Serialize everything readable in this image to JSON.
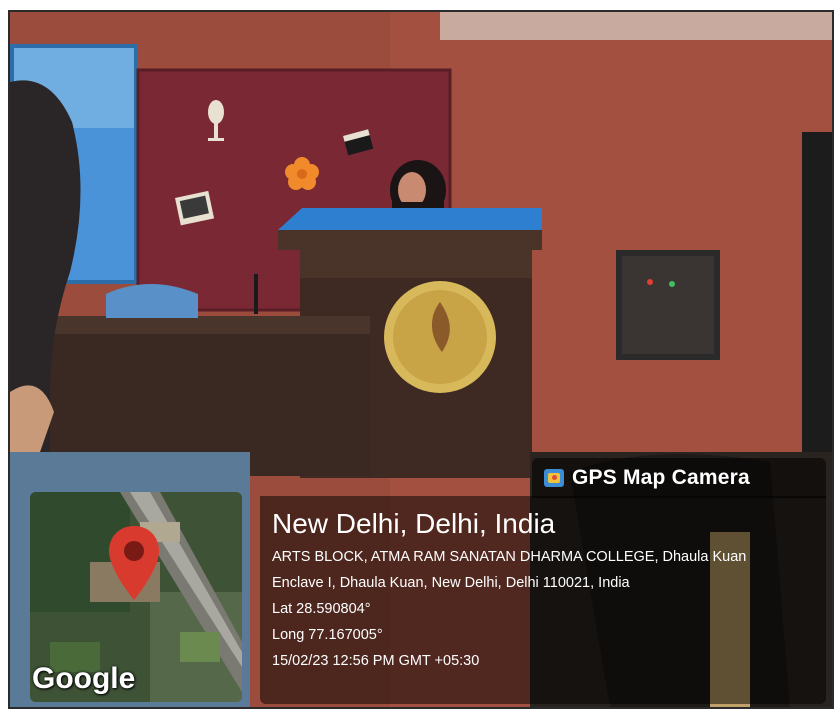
{
  "overlay": {
    "badge_label": "GPS Map Camera",
    "map_watermark": "Google",
    "location_title": "New Delhi, Delhi, India",
    "address": "ARTS BLOCK, ATMA RAM SANATAN DHARMA COLLEGE, Dhaula Kuan Enclave I, Dhaula Kuan, New Delhi, Delhi 110021, India",
    "latitude": "Lat 28.590804°",
    "longitude": "Long 77.167005°",
    "timestamp": "15/02/23 12:56 PM GMT +05:30"
  },
  "colors": {
    "wall": "#9b4c3c",
    "board": "#7a2834",
    "podium": "#3e2a22",
    "podium_top": "#2f7fd0",
    "marker": "#d93a2e",
    "overlay_bg": "rgba(0,0,0,0.5)"
  },
  "icons": [
    "gps-map-camera-icon",
    "location-pin-icon"
  ]
}
